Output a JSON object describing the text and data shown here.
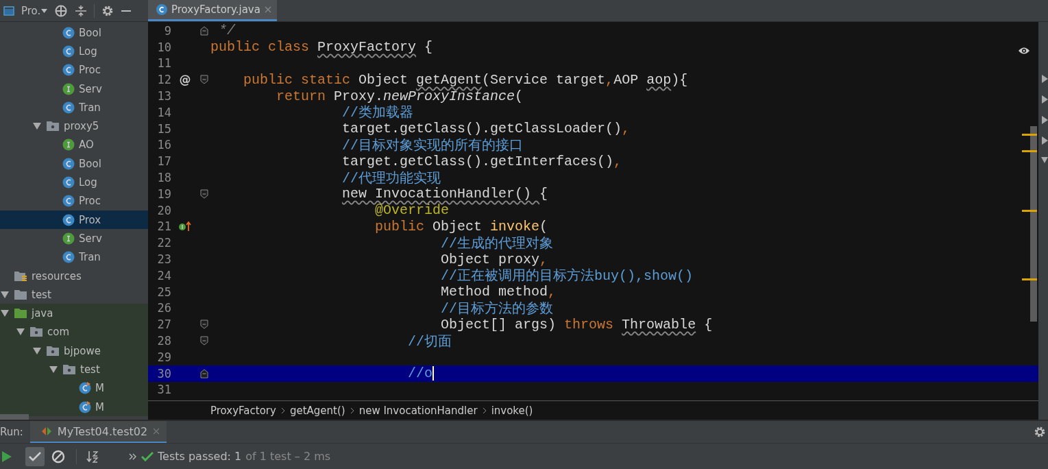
{
  "project_panel": {
    "title": "Pro.",
    "tree": [
      {
        "children": [
          {
            "children": [
              {
                "children": [
                  {
                    "children": [
                      {
                        "label": "Bool",
                        "kind": "class",
                        "selected": false
                      },
                      {
                        "label": "Log",
                        "kind": "class",
                        "selected": false
                      },
                      {
                        "label": "Proc",
                        "kind": "class",
                        "selected": false
                      },
                      {
                        "label": "Serv",
                        "kind": "interface",
                        "selected": false
                      },
                      {
                        "label": "Tran",
                        "kind": "class",
                        "selected": false
                      }
                    ]
                  },
                  {
                    "label": "proxy5",
                    "kind": "package",
                    "selected": false,
                    "expanded": true,
                    "children": [
                      {
                        "label": "AO",
                        "kind": "interface",
                        "selected": false
                      },
                      {
                        "label": "Bool",
                        "kind": "class",
                        "selected": false
                      },
                      {
                        "label": "Log",
                        "kind": "class",
                        "selected": false
                      },
                      {
                        "label": "Proc",
                        "kind": "class",
                        "selected": false
                      },
                      {
                        "label": "Prox",
                        "kind": "class",
                        "selected": true
                      },
                      {
                        "label": "Serv",
                        "kind": "interface",
                        "selected": false
                      },
                      {
                        "label": "Tran",
                        "kind": "class",
                        "selected": false
                      }
                    ]
                  }
                ]
              }
            ]
          },
          {
            "label": "resources",
            "kind": "resources",
            "selected": false
          }
        ]
      },
      {
        "label": "test",
        "kind": "folder",
        "selected": false,
        "expanded": true,
        "children": [
          {
            "label": "java",
            "kind": "source_root",
            "selected": false,
            "expanded": true,
            "test_scope": true,
            "children": [
              {
                "label": "com",
                "kind": "package",
                "selected": false,
                "expanded": true,
                "test_scope": true,
                "children": [
                  {
                    "label": "bjpowe",
                    "kind": "package",
                    "selected": false,
                    "expanded": true,
                    "test_scope": true,
                    "children": [
                      {
                        "label": "test",
                        "kind": "package",
                        "selected": false,
                        "expanded": true,
                        "test_scope": true,
                        "children": [
                          {
                            "label": "M",
                            "kind": "test_class",
                            "selected": false,
                            "test_scope": true
                          },
                          {
                            "label": "M",
                            "kind": "test_class",
                            "selected": false,
                            "test_scope": true
                          }
                        ]
                      }
                    ]
                  }
                ]
              }
            ]
          }
        ]
      }
    ]
  },
  "editor_tabs": [
    {
      "label": "ProxyFactory.java",
      "selected": true
    }
  ],
  "code_lines": [
    {
      "number": "9",
      "gutter": [
        {
          "kind": "fold_end"
        }
      ],
      "selected": false,
      "tokens": [
        {
          "text": " */",
          "kind": "doc"
        }
      ]
    },
    {
      "number": "10",
      "selected": false,
      "tokens": [
        {
          "text": "public class ",
          "kind": "kw"
        },
        {
          "text": "ProxyFactory",
          "kind": "warn"
        },
        {
          "text": " {",
          "kind": "text"
        }
      ]
    },
    {
      "number": "11",
      "selected": false
    },
    {
      "number": "12",
      "marker": "@",
      "gutter": [
        {
          "kind": "fold_start"
        }
      ],
      "selected": false,
      "tokens": [
        {
          "text": "    public static ",
          "kind": "kw"
        },
        {
          "text": "Object ",
          "kind": "text"
        },
        {
          "text": "getAgent",
          "kind": "warn"
        },
        {
          "text": "(Service target",
          "kind": "text"
        },
        {
          "text": ",",
          "kind": "kw"
        },
        {
          "text": "AOP ",
          "kind": "text"
        },
        {
          "text": "aop",
          "kind": "warn"
        },
        {
          "text": "){",
          "kind": "text"
        }
      ]
    },
    {
      "number": "13",
      "selected": false,
      "tokens": [
        {
          "text": "        return ",
          "kind": "kw"
        },
        {
          "text": "Proxy.",
          "kind": "text"
        },
        {
          "text": "newProxyInstance",
          "kind": "italic"
        },
        {
          "text": "(",
          "kind": "text"
        }
      ]
    },
    {
      "number": "14",
      "selected": false,
      "tokens": [
        {
          "text": "                //类加载器",
          "kind": "comment"
        }
      ]
    },
    {
      "number": "15",
      "selected": false,
      "tokens": [
        {
          "text": "                target.getClass().getClassLoader()",
          "kind": "text"
        },
        {
          "text": ",",
          "kind": "kw"
        }
      ]
    },
    {
      "number": "16",
      "selected": false,
      "tokens": [
        {
          "text": "                //目标对象实现的所有的接口",
          "kind": "comment"
        }
      ]
    },
    {
      "number": "17",
      "selected": false,
      "tokens": [
        {
          "text": "                target.getClass().getInterfaces()",
          "kind": "text"
        },
        {
          "text": ",",
          "kind": "kw"
        }
      ]
    },
    {
      "number": "18",
      "selected": false,
      "tokens": [
        {
          "text": "                //代理功能实现",
          "kind": "comment"
        }
      ]
    },
    {
      "number": "19",
      "gutter": [
        {
          "kind": "fold_start"
        }
      ],
      "selected": false,
      "tokens": [
        {
          "text": "                new InvocationHandler() ",
          "kind": "warn"
        },
        {
          "text": "{",
          "kind": "text"
        }
      ]
    },
    {
      "number": "20",
      "selected": false,
      "tokens": [
        {
          "text": "                    @Override",
          "kind": "annotation"
        }
      ]
    },
    {
      "number": "21",
      "gutter": [
        {
          "kind": "implements"
        }
      ],
      "selected": false,
      "tokens": [
        {
          "text": "                    public ",
          "kind": "kw"
        },
        {
          "text": "Object ",
          "kind": "text"
        },
        {
          "text": "invoke",
          "kind": "method"
        },
        {
          "text": "(",
          "kind": "text"
        }
      ]
    },
    {
      "number": "22",
      "selected": false,
      "tokens": [
        {
          "text": "                            //生成的代理对象",
          "kind": "comment"
        }
      ]
    },
    {
      "number": "23",
      "selected": false,
      "tokens": [
        {
          "text": "                            Object proxy",
          "kind": "text"
        },
        {
          "text": ",",
          "kind": "kw"
        }
      ]
    },
    {
      "number": "24",
      "selected": false,
      "tokens": [
        {
          "text": "                            //正在被调用的目标方法buy(),show()",
          "kind": "comment"
        }
      ]
    },
    {
      "number": "25",
      "selected": false,
      "tokens": [
        {
          "text": "                            Method method",
          "kind": "text"
        },
        {
          "text": ",",
          "kind": "kw"
        }
      ]
    },
    {
      "number": "26",
      "selected": false,
      "tokens": [
        {
          "text": "                            //目标方法的参数",
          "kind": "comment"
        }
      ]
    },
    {
      "number": "27",
      "gutter": [
        {
          "kind": "fold_start"
        }
      ],
      "selected": false,
      "tokens": [
        {
          "text": "                            Object[] args) ",
          "kind": "text"
        },
        {
          "text": "throws ",
          "kind": "kw"
        },
        {
          "text": "Throwable",
          "kind": "warn"
        },
        {
          "text": " {",
          "kind": "text"
        }
      ]
    },
    {
      "number": "28",
      "gutter": [
        {
          "kind": "fold_start"
        }
      ],
      "selected": false,
      "tokens": [
        {
          "text": "                        //切面",
          "kind": "comment"
        }
      ]
    },
    {
      "number": "29",
      "selected": false
    },
    {
      "number": "30",
      "gutter": [
        {
          "kind": "fold_end"
        }
      ],
      "selected": true,
      "tokens": [
        {
          "text": "                        //o",
          "kind": "comment"
        }
      ]
    },
    {
      "number": "31",
      "selected": false
    }
  ],
  "breadcrumbs": [
    "ProxyFactory",
    "getAgent()",
    "new InvocationHandler",
    "invoke()"
  ],
  "run_panel": {
    "label": "Run:",
    "tabs": [
      {
        "label": "MyTest04.test02",
        "selected": true
      }
    ],
    "show_passed": true,
    "show_ignored": false,
    "status": "Tests passed: 1",
    "status_detail": "of 1 test – 2 ms"
  }
}
